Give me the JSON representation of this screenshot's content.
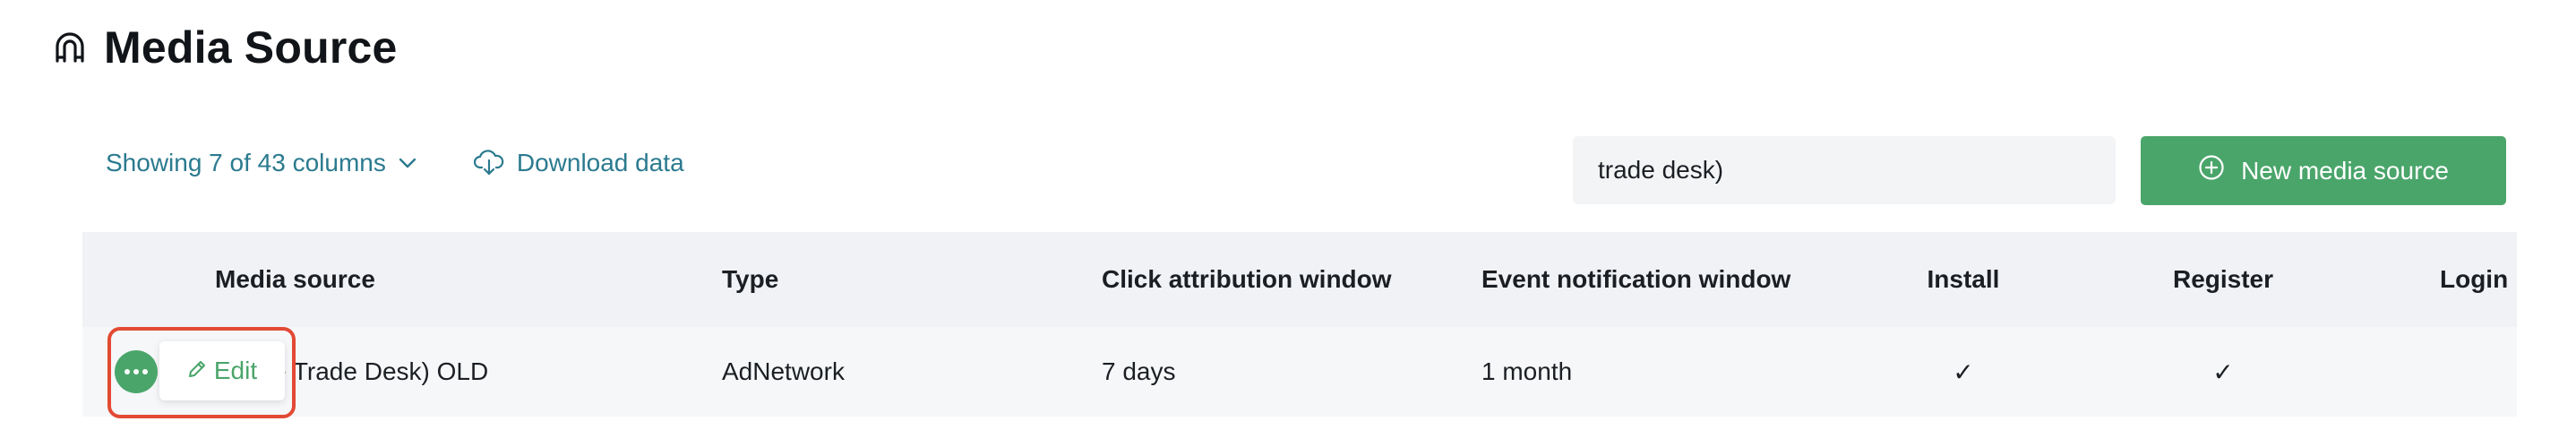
{
  "page": {
    "title": "Media Source"
  },
  "toolbar": {
    "columns_label": "Showing 7 of 43 columns",
    "download_label": "Download data",
    "search_value": "trade desk)",
    "new_button_label": "New media source"
  },
  "table": {
    "headers": {
      "media_source": "Media source",
      "type": "Type",
      "click_window": "Click attribution window",
      "event_window": "Event notification window",
      "install": "Install",
      "register": "Register",
      "login": "Login"
    },
    "row": {
      "media_source": "(The Trade Desk) OLD",
      "type": "AdNetwork",
      "click_window": "7 days",
      "event_window": "1 month",
      "install": "✓",
      "register": "✓"
    },
    "row_action": {
      "edit_label": "Edit"
    }
  },
  "colors": {
    "accent": "#4aa56a",
    "link": "#2b7a8f",
    "highlight": "#e24a34"
  }
}
